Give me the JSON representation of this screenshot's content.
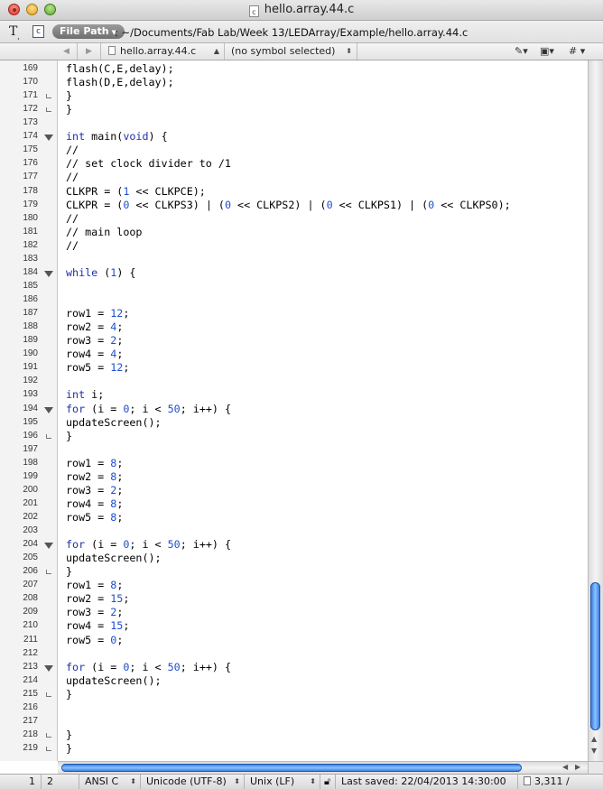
{
  "window": {
    "title": "hello.array.44.c",
    "doc_icon_glyph": "c"
  },
  "path_bar": {
    "text_tool_glyph": "T",
    "lang_glyph": "c",
    "file_path_label": "File Path",
    "path": ": ~/Documents/Fab Lab/Week 13/LEDArray/Example/hello.array.44.c"
  },
  "navigation": {
    "file": "hello.array.44.c",
    "symbol": "(no symbol selected)"
  },
  "editor": {
    "lines": [
      {
        "n": "169",
        "text": "flash(C,E,delay);"
      },
      {
        "n": "170",
        "text": "flash(D,E,delay);"
      },
      {
        "n": "171",
        "text": "}",
        "fold": "close"
      },
      {
        "n": "172",
        "text": "}",
        "fold": "close"
      },
      {
        "n": "173",
        "text": ""
      },
      {
        "n": "174",
        "text": "int main(void) {",
        "fold": "open"
      },
      {
        "n": "175",
        "text": "//"
      },
      {
        "n": "176",
        "text": "// set clock divider to /1"
      },
      {
        "n": "177",
        "text": "//"
      },
      {
        "n": "178",
        "text": "CLKPR = (1 << CLKPCE);"
      },
      {
        "n": "179",
        "text": "CLKPR = (0 << CLKPS3) | (0 << CLKPS2) | (0 << CLKPS1) | (0 << CLKPS0);"
      },
      {
        "n": "180",
        "text": "//"
      },
      {
        "n": "181",
        "text": "// main loop"
      },
      {
        "n": "182",
        "text": "//"
      },
      {
        "n": "183",
        "text": ""
      },
      {
        "n": "184",
        "text": "while (1) {",
        "fold": "open"
      },
      {
        "n": "185",
        "text": ""
      },
      {
        "n": "186",
        "text": ""
      },
      {
        "n": "187",
        "text": "row1 = 12;"
      },
      {
        "n": "188",
        "text": "row2 = 4;"
      },
      {
        "n": "189",
        "text": "row3 = 2;"
      },
      {
        "n": "190",
        "text": "row4 = 4;"
      },
      {
        "n": "191",
        "text": "row5 = 12;"
      },
      {
        "n": "192",
        "text": ""
      },
      {
        "n": "193",
        "text": "int i;"
      },
      {
        "n": "194",
        "text": "for (i = 0; i < 50; i++) {",
        "fold": "open"
      },
      {
        "n": "195",
        "text": "updateScreen();"
      },
      {
        "n": "196",
        "text": "}",
        "fold": "close"
      },
      {
        "n": "197",
        "text": ""
      },
      {
        "n": "198",
        "text": "row1 = 8;"
      },
      {
        "n": "199",
        "text": "row2 = 8;"
      },
      {
        "n": "200",
        "text": "row3 = 2;"
      },
      {
        "n": "201",
        "text": "row4 = 8;"
      },
      {
        "n": "202",
        "text": "row5 = 8;"
      },
      {
        "n": "203",
        "text": ""
      },
      {
        "n": "204",
        "text": "for (i = 0; i < 50; i++) {",
        "fold": "open"
      },
      {
        "n": "205",
        "text": "updateScreen();"
      },
      {
        "n": "206",
        "text": "}",
        "fold": "close"
      },
      {
        "n": "207",
        "text": "row1 = 8;"
      },
      {
        "n": "208",
        "text": "row2 = 15;"
      },
      {
        "n": "209",
        "text": "row3 = 2;"
      },
      {
        "n": "210",
        "text": "row4 = 15;"
      },
      {
        "n": "211",
        "text": "row5 = 0;"
      },
      {
        "n": "212",
        "text": ""
      },
      {
        "n": "213",
        "text": "for (i = 0; i < 50; i++) {",
        "fold": "open"
      },
      {
        "n": "214",
        "text": "updateScreen();"
      },
      {
        "n": "215",
        "text": "}",
        "fold": "close"
      },
      {
        "n": "216",
        "text": ""
      },
      {
        "n": "217",
        "text": ""
      },
      {
        "n": "218",
        "text": "}",
        "fold": "close"
      },
      {
        "n": "219",
        "text": "}",
        "fold": "close"
      }
    ],
    "keywords": [
      "int",
      "void",
      "while",
      "for"
    ],
    "colors": {
      "keyword": "#1d31a7",
      "number": "#1c4ecf"
    }
  },
  "status_bar": {
    "line": "1",
    "column": "2",
    "syntax": "ANSI C",
    "encoding": "Unicode (UTF-8)",
    "line_endings": "Unix (LF)",
    "last_saved": "Last saved: 22/04/2013 14:30:00",
    "size": "3,311 /"
  }
}
